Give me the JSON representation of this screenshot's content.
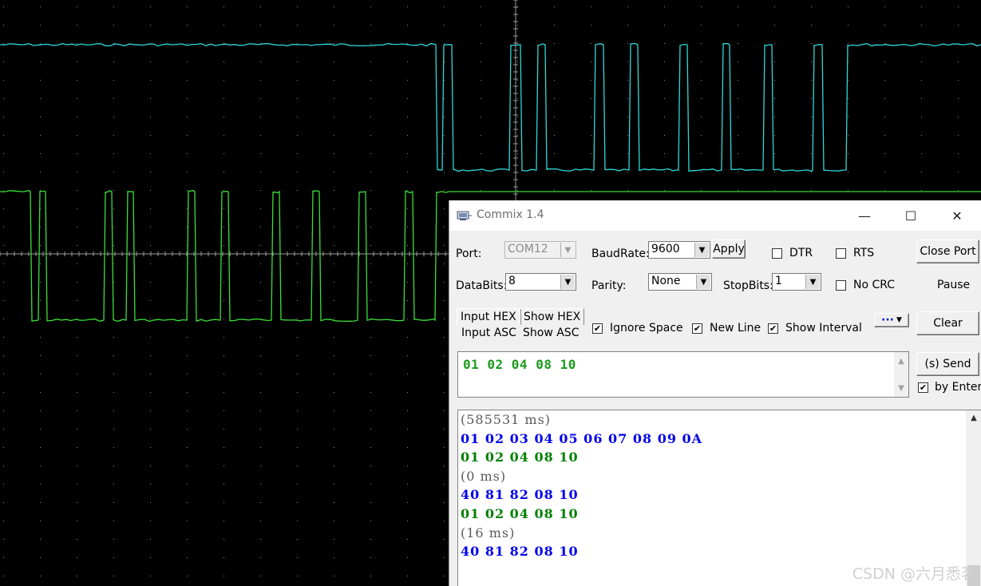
{
  "scope": {
    "trace_colors": {
      "upper": "#2fd8d8",
      "lower": "#3adf3a",
      "grid": "#8a8a8a"
    }
  },
  "window": {
    "title": "Commix 1.4",
    "controls": {
      "minimize": "—",
      "maximize": "☐",
      "close": "✕"
    }
  },
  "settings": {
    "port_label": "Port:",
    "port_value": "COM12",
    "baud_label": "BaudRate:",
    "baud_value": "9600",
    "apply_label": "Apply",
    "dtr_label": "DTR",
    "rts_label": "RTS",
    "close_port_label": "Close Port",
    "databits_label": "DataBits:",
    "databits_value": "8",
    "parity_label": "Parity:",
    "parity_value": "None",
    "stopbits_label": "StopBits:",
    "stopbits_value": "1",
    "nocrc_label": "No CRC",
    "pause_label": "Pause"
  },
  "options": {
    "input_hex": "Input HEX",
    "input_asc": "Input ASC",
    "show_hex": "Show HEX",
    "show_asc": "Show ASC",
    "ignore_space": "Ignore Space",
    "new_line": "New Line",
    "show_interval": "Show Interval",
    "more_label": "···",
    "clear_label": "Clear"
  },
  "send": {
    "text": "01 02 04 08 10",
    "send_label": "(s) Send",
    "by_enter_label": "by Enter"
  },
  "receive": {
    "lines": [
      {
        "text": "(585531 ms)",
        "kind": "gray"
      },
      {
        "text": "01 02 03 04 05 06 07 08 09 0A",
        "kind": "blue"
      },
      {
        "text": "01 02 04 08 10",
        "kind": "green"
      },
      {
        "text": "(0 ms)",
        "kind": "gray"
      },
      {
        "text": "40 81 82 08 10",
        "kind": "blue"
      },
      {
        "text": "01 02 04 08 10",
        "kind": "green"
      },
      {
        "text": "(16 ms)",
        "kind": "gray"
      },
      {
        "text": "40 81 82 08 10",
        "kind": "blue"
      }
    ]
  },
  "watermark": "CSDN @六月悉茗"
}
